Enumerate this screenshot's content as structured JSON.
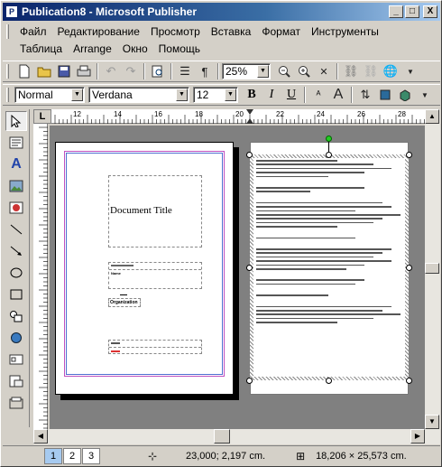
{
  "window": {
    "title": "Publication8 - Microsoft Publisher",
    "app_icon": "P"
  },
  "controls": {
    "minimize": "_",
    "maximize": "□",
    "close": "X"
  },
  "menu": {
    "row1": [
      "Файл",
      "Редактирование",
      "Просмотр",
      "Вставка",
      "Формат",
      "Инструменты"
    ],
    "row2": [
      "Таблица",
      "Arrange",
      "Окно",
      "Помощь"
    ]
  },
  "standard_toolbar": {
    "zoom": "25%"
  },
  "format_toolbar": {
    "style": "Normal",
    "font": "Verdana",
    "size": "12",
    "bold": "B",
    "italic": "I",
    "underline": "U"
  },
  "ruler": {
    "corner": "L",
    "h_labels": [
      "12",
      "14",
      "16",
      "18",
      "20",
      "22",
      "24",
      "26",
      "28"
    ]
  },
  "document": {
    "title": "Document Title",
    "label_a": "Organization",
    "field_label": "Name"
  },
  "status": {
    "pages": [
      "1",
      "2",
      "3"
    ],
    "position": "23,000; 2,197 cm.",
    "size": "18,206 × 25,573 cm."
  },
  "colors": {
    "titlebar": "#0a246a",
    "selection": "#00aa00"
  }
}
